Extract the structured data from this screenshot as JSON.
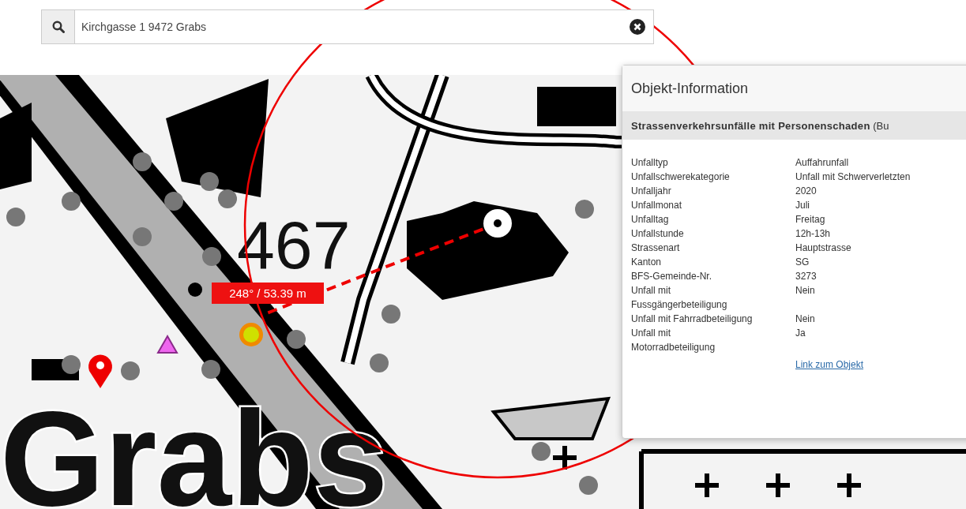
{
  "search": {
    "value": "Kirchgasse 1 9472 Grabs"
  },
  "map": {
    "labels": [
      "467",
      "Grabs"
    ],
    "measurement": "248° / 53.39 m"
  },
  "info_panel": {
    "title": "Objekt-Information",
    "layer_title": "**Strassenverkehrsunfälle mit Personenschaden** (Bu",
    "rows": [
      {
        "label": "Unfalltyp",
        "value": "Auffahrunfall"
      },
      {
        "label": "Unfallschwerekategorie",
        "value": "Unfall mit Schwerverletzten"
      },
      {
        "label": "Unfalljahr",
        "value": "2020"
      },
      {
        "label": "Unfallmonat",
        "value": "Juli"
      },
      {
        "label": "Unfalltag",
        "value": "Freitag"
      },
      {
        "label": "Unfallstunde",
        "value": "12h-13h"
      },
      {
        "label": "Strassenart",
        "value": "Hauptstrasse"
      },
      {
        "label": "Kanton",
        "value": "SG"
      },
      {
        "label": "BFS-Gemeinde-Nr.",
        "value": "3273"
      },
      {
        "label": "Unfall mit Fussgängerbeteiligung",
        "value": "Nein"
      },
      {
        "label": "Unfall mit Fahrradbeteiligung",
        "value": "Nein"
      },
      {
        "label": "Unfall mit Motorradbeteiligung",
        "value": "Ja"
      }
    ],
    "link": "Link zum Objekt"
  }
}
